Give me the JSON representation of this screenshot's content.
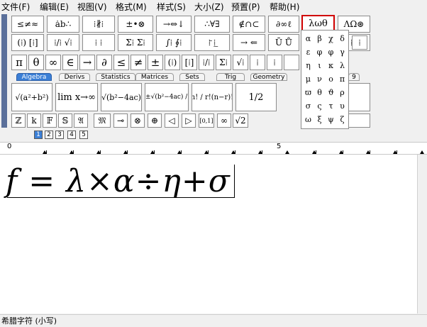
{
  "menu": [
    "文件(F)",
    "编辑(E)",
    "视图(V)",
    "格式(M)",
    "样式(S)",
    "大小(Z)",
    "预置(P)",
    "帮助(H)"
  ],
  "toolbar_row1": [
    "≤≠≈",
    "ȧb∴",
    "⁞∦⁞",
    "±•⊗",
    "→⇔↓",
    "∴∀∃",
    "∉∩⊂",
    "∂∞ℓ",
    "λωθ",
    "ΛΩ⊛"
  ],
  "toolbar_row2": [
    "(⁞) [⁞]",
    "⁞/⁞ √⁞",
    "⁞ ⁞",
    "Σ⁞ Σ⁞",
    "∫⁞ ∮⁞",
    "⁞̄ ⁞̲",
    "→ ⇐",
    "Ū Ů",
    "⁞⁞⁞",
    "⁞"
  ],
  "toolbar_row3": [
    "π",
    "θ",
    "∞",
    "∈",
    "→",
    "∂",
    "≤",
    "≠",
    "±",
    "(⁞)",
    "[⁞]",
    "⁞/⁞",
    "Σ⁞",
    "√⁞",
    "⁞",
    "⁞"
  ],
  "tabs": [
    "Algebra",
    "Derivs",
    "Statistics",
    "Matrices",
    "Sets",
    "Trig",
    "Geometry",
    "9"
  ],
  "templates": [
    "√(a²+b²)",
    "lim x→∞",
    "√(b²−4ac)",
    "−b±√(b²−4ac) / 2a",
    "n! / r!(n−r)!",
    "1/2"
  ],
  "toolbar_row5": [
    "ℤ",
    "k",
    "𝔽",
    "𝕊",
    "𝔄",
    "𝔐",
    "⊸",
    "⊗",
    "⊕",
    "◁",
    "▷",
    "[0,1]",
    "∞",
    "√2"
  ],
  "nav_buttons": [
    "1",
    "2",
    "3",
    "4",
    "5"
  ],
  "ruler": {
    "start": "0",
    "mid": "5"
  },
  "formula": "f = λ×α÷η+σ",
  "status_text": "希腊字符 (小写)",
  "greek_selected": "λ ω θ",
  "greek_palette": [
    "α",
    "β",
    "χ",
    "δ",
    "ε",
    "φ",
    "φ",
    "γ",
    "η",
    "ι",
    "κ",
    "λ",
    "μ",
    "ν",
    "ο",
    "π",
    "ϖ",
    "θ",
    "ϑ",
    "ρ",
    "σ",
    "ς",
    "τ",
    "υ",
    "ω",
    "ξ",
    "ψ",
    "ζ"
  ]
}
